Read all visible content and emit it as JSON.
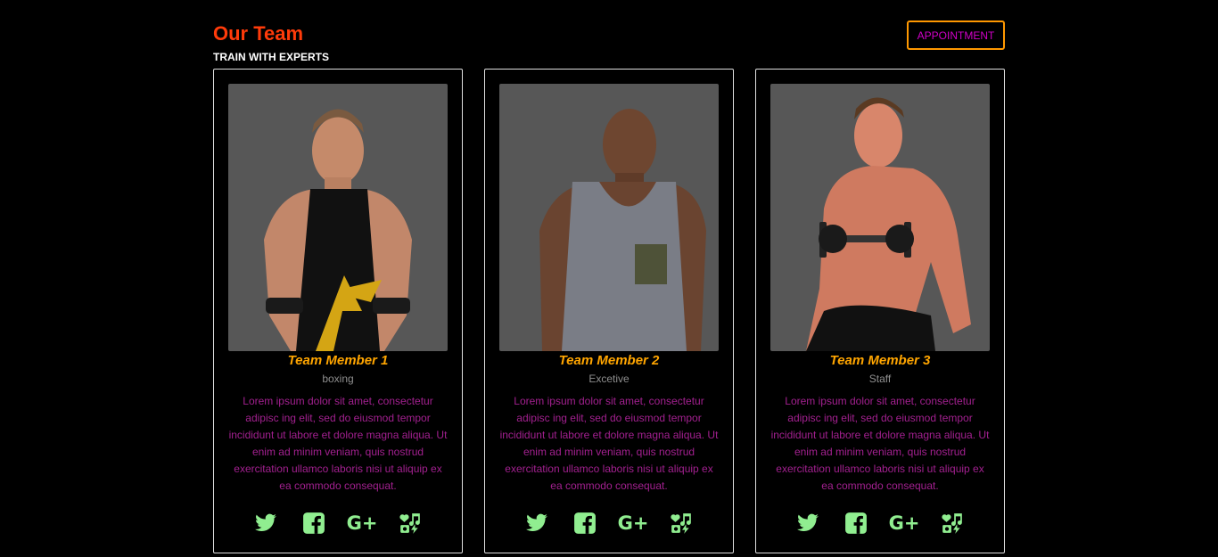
{
  "header": {
    "title": "Our Team",
    "subtitle": "TRAIN WITH EXPERTS",
    "appointment_label": "APPOINTMENT"
  },
  "colors": {
    "title": "#ff3b0a",
    "name": "#ffa500",
    "description": "#a2208f",
    "icons": "#90ee90",
    "button_border": "#ff9800",
    "button_text": "#d100c8"
  },
  "members": [
    {
      "name": "Team Member 1",
      "role": "boxing",
      "description": "Lorem ipsum dolor sit amet, consectetur adipisc ing elit, sed do eiusmod tempor incididunt ut labore et dolore magna aliqua. Ut enim ad minim veniam, quis nostrud exercitation ullamco laboris nisi ut aliquip ex ea commodo consequat."
    },
    {
      "name": "Team Member 2",
      "role": "Excetive",
      "description": "Lorem ipsum dolor sit amet, consectetur adipisc ing elit, sed do eiusmod tempor incididunt ut labore et dolore magna aliqua. Ut enim ad minim veniam, quis nostrud exercitation ullamco laboris nisi ut aliquip ex ea commodo consequat."
    },
    {
      "name": "Team Member 3",
      "role": "Staff",
      "description": "Lorem ipsum dolor sit amet, consectetur adipisc ing elit, sed do eiusmod tempor incididunt ut labore et dolore magna aliqua. Ut enim ad minim veniam, quis nostrud exercitation ullamco laboris nisi ut aliquip ex ea commodo consequat."
    }
  ],
  "social_icons": [
    "twitter-icon",
    "facebook-icon",
    "google-plus-icon",
    "misc-apps-icon"
  ],
  "social_gplus_glyph": "G+"
}
